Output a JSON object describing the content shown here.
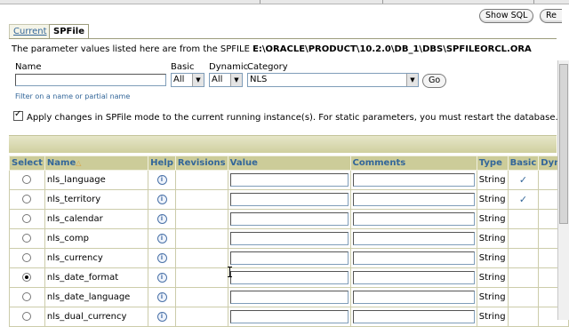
{
  "toolbar": {
    "show_sql_label": "Show SQL",
    "revert_label": "Re"
  },
  "tabs": [
    {
      "label": "Current",
      "active": false
    },
    {
      "label": "SPFile",
      "active": true
    }
  ],
  "info": {
    "prefix": "The parameter values listed here are from the SPFILE",
    "path": "E:\\ORACLE\\PRODUCT\\10.2.0\\DB_1\\DBS\\SPFILEORCL.ORA"
  },
  "filter": {
    "name_label": "Name",
    "name_value": "",
    "basic_label": "Basic",
    "basic_value": "All",
    "dynamic_label": "Dynamic",
    "dynamic_value": "All",
    "category_label": "Category",
    "category_value": "NLS",
    "go_label": "Go",
    "hint": "Filter on a name or partial name"
  },
  "apply_changes": {
    "checked": true,
    "label": "Apply changes in SPFile mode to the current running instance(s). For static parameters, you must restart the database."
  },
  "table": {
    "headers": {
      "select": "Select",
      "name": "Name",
      "name_sort": "△",
      "help": "Help",
      "revisions": "Revisions",
      "value": "Value",
      "comments": "Comments",
      "type": "Type",
      "basic": "Basic",
      "dynamic": "Dyna"
    },
    "rows": [
      {
        "name": "nls_language",
        "type": "String",
        "basic": "✓",
        "selected": false
      },
      {
        "name": "nls_territory",
        "type": "String",
        "basic": "✓",
        "selected": false
      },
      {
        "name": "nls_calendar",
        "type": "String",
        "basic": "",
        "selected": false
      },
      {
        "name": "nls_comp",
        "type": "String",
        "basic": "",
        "selected": false
      },
      {
        "name": "nls_currency",
        "type": "String",
        "basic": "",
        "selected": false
      },
      {
        "name": "nls_date_format",
        "type": "String",
        "basic": "",
        "selected": true
      },
      {
        "name": "nls_date_language",
        "type": "String",
        "basic": "",
        "selected": false
      },
      {
        "name": "nls_dual_currency",
        "type": "String",
        "basic": "",
        "selected": false
      }
    ]
  },
  "colors": {
    "header_bg": "#cccc99",
    "link": "#336699",
    "bar": "#d8d8b0"
  }
}
